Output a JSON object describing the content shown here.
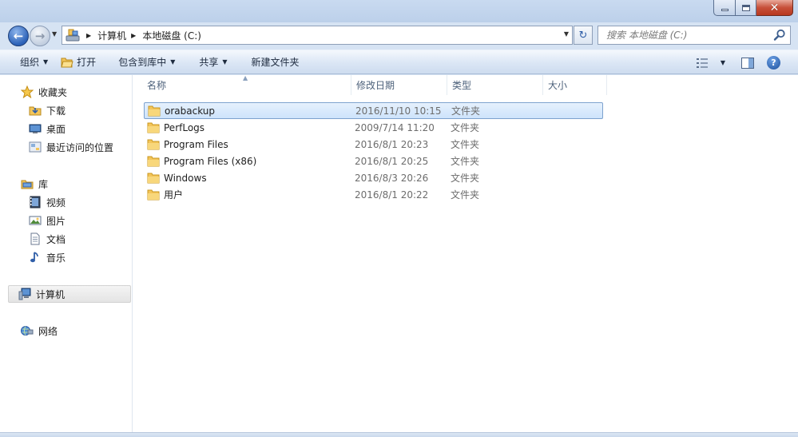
{
  "window": {
    "minimize_icon": "minimize-icon",
    "maximize_icon": "maximize-icon",
    "close_glyph": "✕"
  },
  "nav": {
    "back_glyph": "←",
    "forward_glyph": "→",
    "breadcrumbs": [
      "计算机",
      "本地磁盘 (C:)"
    ],
    "refresh_glyph": "↻"
  },
  "search": {
    "placeholder": "搜索 本地磁盘 (C:)"
  },
  "toolbar": {
    "organize": "组织",
    "open": "打开",
    "include_in_library": "包含到库中",
    "share": "共享",
    "new_folder": "新建文件夹",
    "help": "?"
  },
  "sidebar": {
    "favorites": {
      "label": "收藏夹",
      "items": [
        "下载",
        "桌面",
        "最近访问的位置"
      ]
    },
    "libraries": {
      "label": "库",
      "items": [
        "视频",
        "图片",
        "文档",
        "音乐"
      ]
    },
    "computer": "计算机",
    "network": "网络"
  },
  "columns": [
    "名称",
    "修改日期",
    "类型",
    "大小"
  ],
  "files": [
    {
      "name": "orabackup",
      "date": "2016/11/10 10:15",
      "type": "文件夹"
    },
    {
      "name": "PerfLogs",
      "date": "2009/7/14 11:20",
      "type": "文件夹"
    },
    {
      "name": "Program Files",
      "date": "2016/8/1 20:23",
      "type": "文件夹"
    },
    {
      "name": "Program Files (x86)",
      "date": "2016/8/1 20:25",
      "type": "文件夹"
    },
    {
      "name": "Windows",
      "date": "2016/8/3 20:26",
      "type": "文件夹"
    },
    {
      "name": "用户",
      "date": "2016/8/1 20:22",
      "type": "文件夹"
    }
  ],
  "selected_file": "orabackup",
  "colors": {
    "accent": "#2c62b8",
    "selection_border": "#7da2ce",
    "folder": "#f3c55a"
  }
}
